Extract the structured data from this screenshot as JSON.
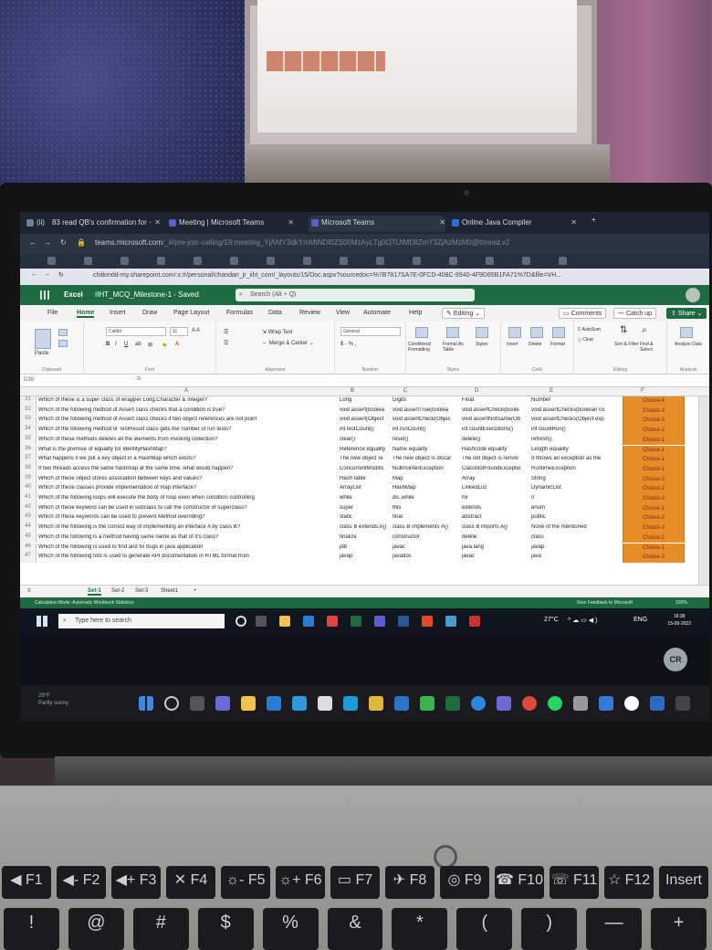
{
  "browser": {
    "tabs": [
      {
        "label": "(ii) ⠀83 read QB's confirmation for ·",
        "color": "#6b7fa0"
      },
      {
        "label": "Meeting | Microsoft Teams",
        "color": "#5b5fc7"
      },
      {
        "label": "Microsoft Teams",
        "color": "#5b5fc7"
      },
      {
        "label": "Online Java Compiler",
        "color": "#2b6de0"
      }
    ],
    "url_host": "teams.microsoft.com",
    "url_rest": "/_#/pre-join-calling/19:meeting_YjAMY3dkYmMtNDI0ZS00MzAyLTg0OTUtMDllZmY3ZjAzMzM0@thread.v2",
    "inner_url": "chitkindd-my.sharepoint.com/:x:/r/personal/chandan_jr_iiht_com/_layouts/15/Doc.aspx?sourcedoc=%7B7817SA7E-0FCD-408C-9940-4F9D65B1FA71%7D&file=VH..."
  },
  "excel": {
    "app": "Excel",
    "doc": "IIHT_MCQ_Milestone-1 - Saved",
    "search": "Search (Alt + Q)",
    "menu": [
      "File",
      "Home",
      "Insert",
      "Draw",
      "Page Layout",
      "Formulas",
      "Data",
      "Review",
      "View",
      "Automate",
      "Help"
    ],
    "editing": "Editing",
    "comments": "Comments",
    "catchup": "Catch up",
    "share": "Share",
    "ribbon": {
      "paste": "Paste",
      "clipboard": "Clipboard",
      "font_name": "Calibri",
      "font_size": "11",
      "font": "Font",
      "wrap": "Wrap Text",
      "merge": "Merge & Center",
      "alignment": "Alignment",
      "number_format": "General",
      "number_symbols": "$ - % ,",
      "number": "Number",
      "cond": "Conditional Formatting",
      "format_table": "Format As Table",
      "styles_btn": "Styles",
      "styles": "Styles",
      "insert": "Insert",
      "delete": "Delete",
      "format": "Format",
      "cells": "Cells",
      "autosum": "AutoSum",
      "clear": "Clear",
      "sort": "Sort & Filter",
      "find": "Find & Select",
      "editing": "Editing",
      "analyze": "Analyze Data",
      "analysis": "Analysis"
    },
    "cell_ref": "D38",
    "fx": "fx",
    "columns": [
      "A",
      "B",
      "C",
      "D",
      "E",
      "F"
    ],
    "rows": [
      {
        "n": "31",
        "q": "Which of these is a super class of wrapper Long,Character & Integer?",
        "a": "Long",
        "b": "Digits",
        "c": "Float",
        "d": "Number",
        "ans": "Choice-4"
      },
      {
        "n": "32",
        "q": "Which of the following method of Assert class checks that a condition is true?",
        "a": "void assert(boolea",
        "b": "void assertTrue(boolea",
        "c": "void assertCheck(boole",
        "d": "void assertChecks(boolean co",
        "ans": "Choice-2"
      },
      {
        "n": "33",
        "q": "Which of the following method of Assert class checks if two object references are not point",
        "a": "void assert(Object",
        "b": "void assertCheck(Objec",
        "c": "void assertNotSame(Ob",
        "d": "void assertChecks(Object exp",
        "ans": "Choice-3"
      },
      {
        "n": "34",
        "q": "Which of the following method of TestResult class gets the number of run tests?",
        "a": "int testCount()",
        "b": "int runCount()",
        "c": "int countExecutions()",
        "d": "int countRun()",
        "ans": "Choice-2"
      },
      {
        "n": "35",
        "q": "Which of these methods deletes all the elements from invoking collection?",
        "a": "clear()",
        "b": "reset()",
        "c": "delete()",
        "d": "refresh()",
        "ans": "Choice-1"
      },
      {
        "n": "36",
        "q": "What is the premise of equality for IdentityHashMap?",
        "a": "Reference equality",
        "b": "Name equality",
        "c": "Hashcode equality",
        "d": "Length equality",
        "ans": "Choice-1"
      },
      {
        "n": "37",
        "q": "What happens if we put a key object in a HashMap which exists?",
        "a": "The new object re",
        "b": "The new object is discar",
        "c": "The old object is remov",
        "d": "It throws an exception as the",
        "ans": "Choice-1"
      },
      {
        "n": "38",
        "q": "If two threads access the same hashmap at the same time, what would happen?",
        "a": "ConcurrentModific",
        "b": "NullPointerException",
        "c": "ClassNotFoundExceptio",
        "d": "RuntimeException",
        "ans": "Choice-1"
      },
      {
        "n": "39",
        "q": "Which of these object stores association between keys and values?",
        "a": "Hash table",
        "b": "Map",
        "c": "Array",
        "d": "String",
        "ans": "Choice-2"
      },
      {
        "n": "40",
        "q": "Which of these classes provide implementation of map interface?",
        "a": "ArrayList",
        "b": "HashMap",
        "c": "LinkedList",
        "d": "DynamicList",
        "ans": "Choice-2"
      },
      {
        "n": "41",
        "q": "Which of the following loops will execute the body of loop even when condition controlling",
        "a": "while",
        "b": "do..while",
        "c": "for",
        "d": "if",
        "ans": "Choice-2"
      },
      {
        "n": "42",
        "q": "Which of these keyword can be used in subclass to call the constructor of superclass?",
        "a": "super",
        "b": "this",
        "c": "extends",
        "d": "enum",
        "ans": "Choice-1"
      },
      {
        "n": "43",
        "q": "Which of these keywords can be used to prevent Method overriding?",
        "a": "static",
        "b": "final",
        "c": "abstract",
        "d": "public",
        "ans": "Choice-2"
      },
      {
        "n": "44",
        "q": "Which of the following is the correct way of implementing an interface A by class B?",
        "a": "class B extends A{}",
        "b": "class B implements A{}",
        "c": "class B imports A{}",
        "d": "None of the mentioned",
        "ans": "Choice-2"
      },
      {
        "n": "45",
        "q": "Which of the following is a method having same name as that of it's class?",
        "a": "finalize",
        "b": "constructor",
        "c": "delete",
        "d": "class",
        "ans": "Choice-2"
      },
      {
        "n": "46",
        "q": "Which of the following is used to find and fix bugs in java application",
        "a": "jdb",
        "b": "javac",
        "c": "java.lang",
        "d": "javap",
        "ans": "Choice-1"
      },
      {
        "n": "47",
        "q": "Which of the following tool is used to generate API documentation in HTML format from",
        "a": "javap",
        "b": "javadoc",
        "c": "javac",
        "d": "java",
        "ans": "Choice-2"
      }
    ],
    "sheets": [
      "Set-1",
      "Set-2",
      "Set-3",
      "Sheet1"
    ],
    "add_sheet": "+",
    "status_left": "Calculation Mode: Automatic    Workbook Statistics",
    "status_right": "Give Feedback to Microsoft",
    "zoom": "100%"
  },
  "taskbar": {
    "search": "Type here to search",
    "temp": "27°C",
    "lang": "ENG",
    "time": "16:38",
    "date": "15-09-2022"
  },
  "meeting": {
    "initials": "CR"
  },
  "outer_taskbar": {
    "temp": "29°F",
    "weather": "Partly sunny"
  },
  "keyboard": {
    "keys": [
      {
        "label": "◀ F1"
      },
      {
        "label": "◀- F2"
      },
      {
        "label": "◀+ F3"
      },
      {
        "label": "✕ F4"
      },
      {
        "label": "☼- F5"
      },
      {
        "label": "☼+ F6"
      },
      {
        "label": "▭ F7"
      },
      {
        "label": "✈ F8"
      },
      {
        "label": "◎ F9"
      },
      {
        "label": "☎ F10"
      },
      {
        "label": "☏ F11"
      },
      {
        "label": "☆ F12"
      },
      {
        "label": "Insert"
      }
    ],
    "row2": [
      "!",
      "@",
      "#",
      "$",
      "%",
      "&",
      "*",
      "(",
      ")",
      "—",
      "+"
    ]
  }
}
